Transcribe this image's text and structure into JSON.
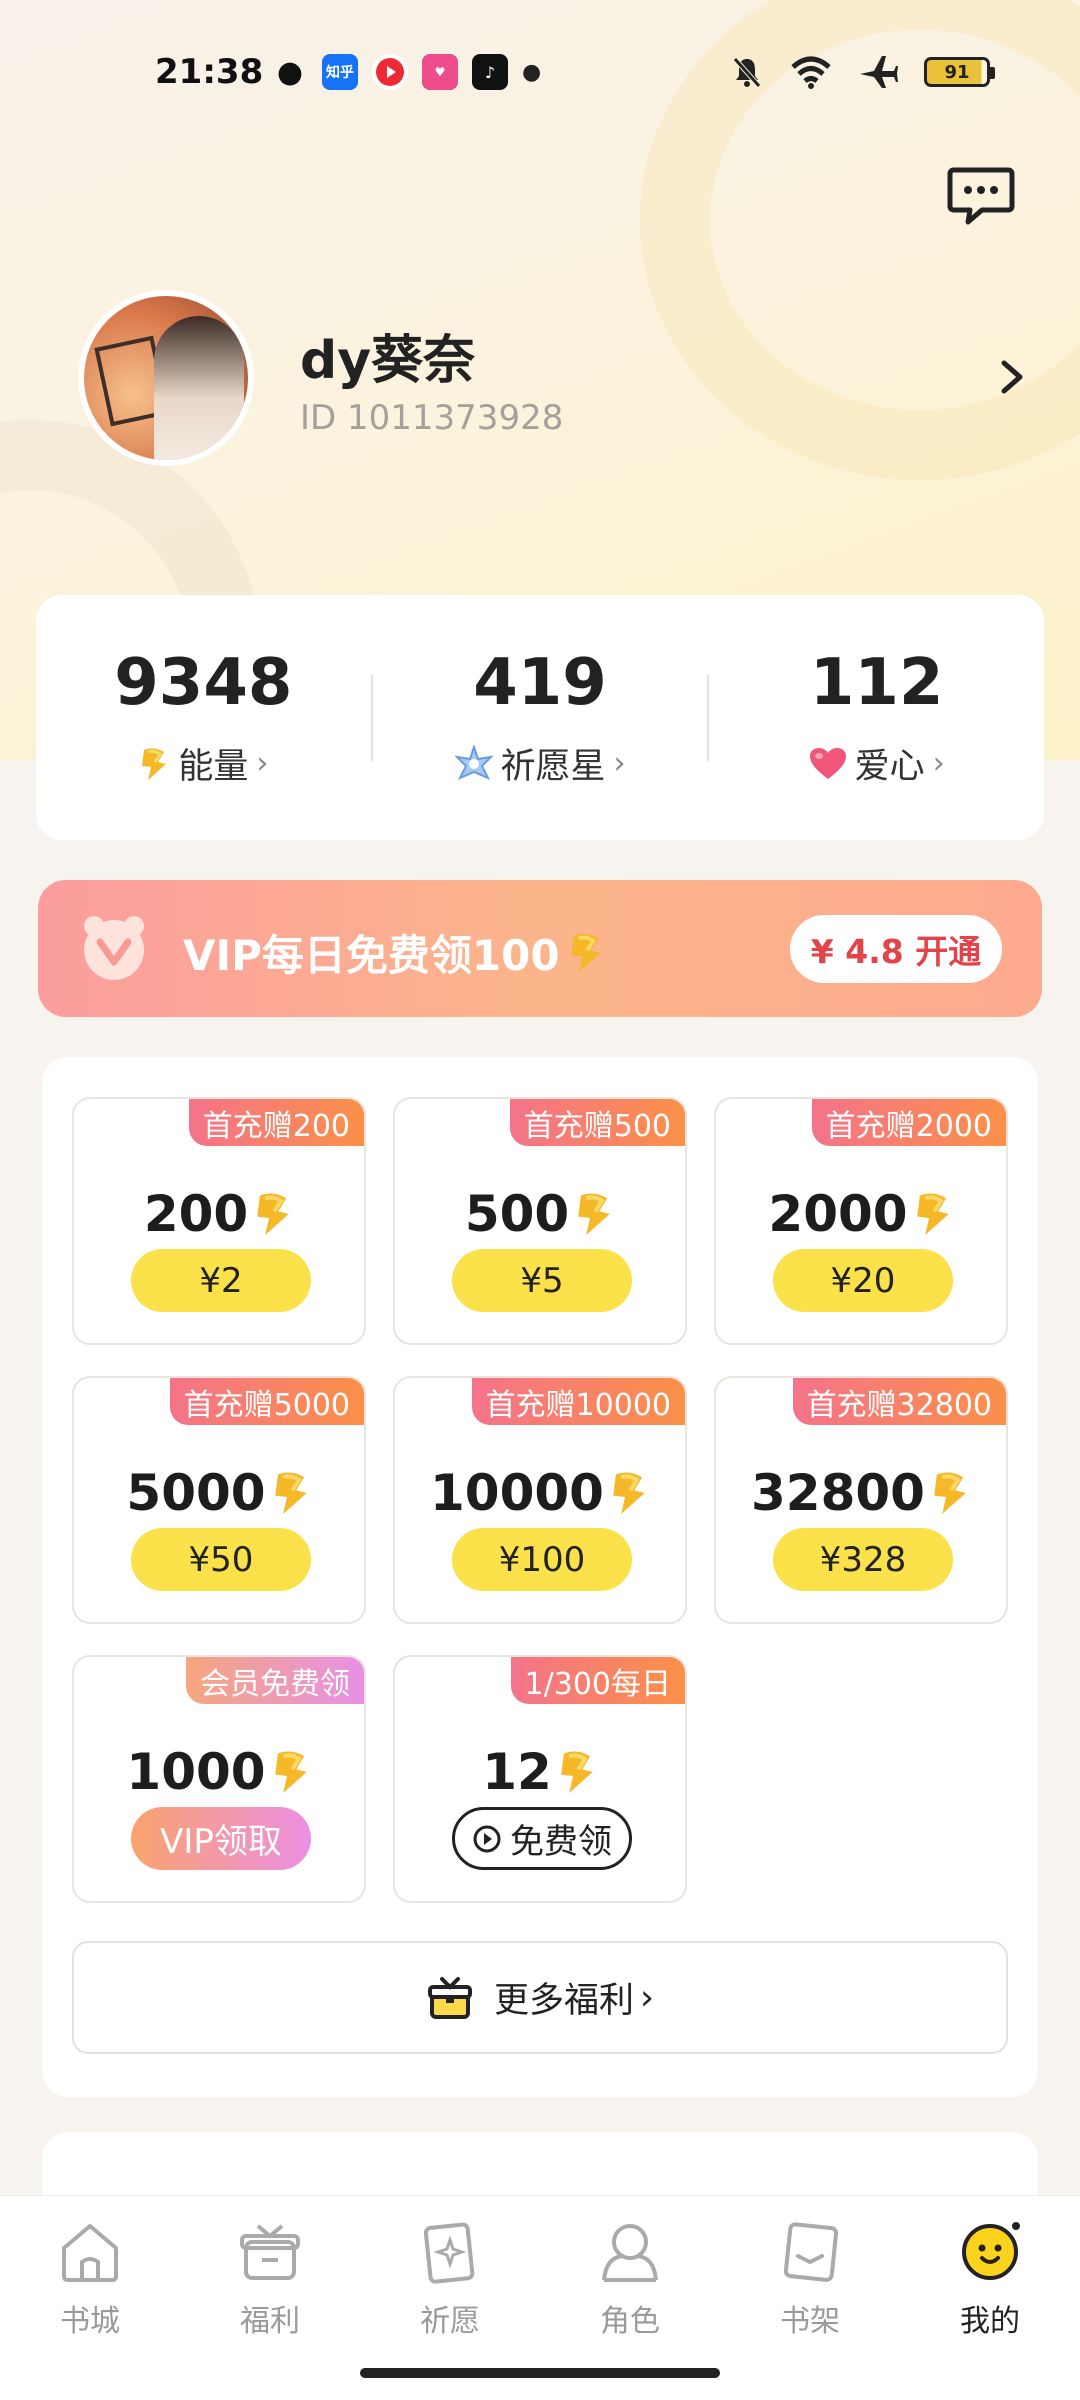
{
  "status": {
    "time": "21:38",
    "app_icons": [
      "wechat-icon",
      "zhihu-icon",
      "video-icon",
      "app-icon",
      "tiktok-icon"
    ],
    "zhihu_label": "知乎",
    "battery": "91"
  },
  "profile": {
    "nickname": "dy葵奈",
    "id": "ID 1011373928"
  },
  "stats": [
    {
      "value": "9348",
      "label": "能量",
      "icon": "energy-icon"
    },
    {
      "value": "419",
      "label": "祈愿星",
      "icon": "star-icon"
    },
    {
      "value": "112",
      "label": "爱心",
      "icon": "heart-icon"
    }
  ],
  "vip": {
    "text": "VIP每日免费领100",
    "button": "¥ 4.8 开通"
  },
  "packages": [
    {
      "tag": "首充赠200",
      "amount": "200",
      "price": "¥2"
    },
    {
      "tag": "首充赠500",
      "amount": "500",
      "price": "¥5"
    },
    {
      "tag": "首充赠2000",
      "amount": "2000",
      "price": "¥20"
    },
    {
      "tag": "首充赠5000",
      "amount": "5000",
      "price": "¥50"
    },
    {
      "tag": "首充赠10000",
      "amount": "10000",
      "price": "¥100"
    },
    {
      "tag": "首充赠32800",
      "amount": "32800",
      "price": "¥328"
    },
    {
      "tag": "会员免费领",
      "amount": "1000",
      "price": "VIP领取"
    },
    {
      "tag": "1/300每日",
      "amount": "12",
      "price": "免费领"
    }
  ],
  "more_welfare": "更多福利",
  "tabs": [
    {
      "label": "书城",
      "icon": "home-icon"
    },
    {
      "label": "福利",
      "icon": "gift-icon"
    },
    {
      "label": "祈愿",
      "icon": "wish-card-icon"
    },
    {
      "label": "角色",
      "icon": "character-icon"
    },
    {
      "label": "书架",
      "icon": "bookshelf-icon"
    },
    {
      "label": "我的",
      "icon": "mascot-icon",
      "active": true
    }
  ],
  "colors": {
    "accent_yellow": "#fbe14a",
    "tag_gradient": [
      "#f4738a",
      "#fb9148"
    ],
    "vip_red": "#e5434a"
  }
}
